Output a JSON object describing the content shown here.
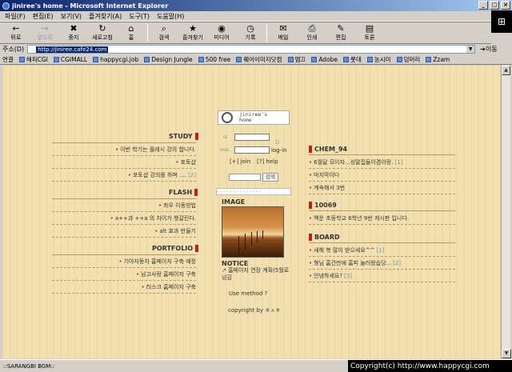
{
  "window": {
    "title": "jiniree's home - Microsoft Internet Explorer"
  },
  "menu": [
    "파일(F)",
    "편집(E)",
    "보기(V)",
    "즐겨찾기(A)",
    "도구(T)",
    "도움말(H)"
  ],
  "toolbar": [
    {
      "label": "뒤로",
      "icon": "back-arrow-icon",
      "glyph": "←",
      "disabled": false
    },
    {
      "label": "앞으로",
      "icon": "forward-arrow-icon",
      "glyph": "→",
      "disabled": true
    },
    {
      "label": "중지",
      "icon": "stop-icon",
      "glyph": "✖",
      "disabled": false
    },
    {
      "label": "새로고침",
      "icon": "refresh-icon",
      "glyph": "↻",
      "disabled": false
    },
    {
      "label": "홈",
      "icon": "home-icon",
      "glyph": "⌂",
      "disabled": false
    },
    {
      "label": "검색",
      "icon": "search-icon",
      "glyph": "⌕",
      "disabled": false
    },
    {
      "label": "즐겨찾기",
      "icon": "favorites-icon",
      "glyph": "★",
      "disabled": false
    },
    {
      "label": "미디어",
      "icon": "media-icon",
      "glyph": "◉",
      "disabled": false
    },
    {
      "label": "기록",
      "icon": "history-icon",
      "glyph": "◷",
      "disabled": false
    },
    {
      "label": "메일",
      "icon": "mail-icon",
      "glyph": "✉",
      "disabled": false
    },
    {
      "label": "인쇄",
      "icon": "print-icon",
      "glyph": "⎙",
      "disabled": false
    },
    {
      "label": "편집",
      "icon": "edit-icon",
      "glyph": "✎",
      "disabled": false
    },
    {
      "label": "토론",
      "icon": "discuss-icon",
      "glyph": "▤",
      "disabled": false
    }
  ],
  "address": {
    "label": "주소(D)",
    "url": "http://jiniree.cafe24.com",
    "go_label": "이동"
  },
  "links": {
    "label": "연결",
    "items": [
      "해피CGI",
      "CGIMALL",
      "happycgi.job",
      "Design Jungle",
      "500 free",
      "웨어이미지닷컴",
      "엠끄",
      "Adobe",
      "롯데",
      "농시미",
      "덩머리",
      "Zzam"
    ]
  },
  "left": {
    "study": {
      "title": "STUDY",
      "items": [
        {
          "text": "이번 학기는 플래시 강의 합니다.",
          "count": ""
        },
        {
          "text": "포토샵",
          "count": ""
        },
        {
          "text": "포토샵 강의를 하며 ....",
          "count": "[2]"
        }
      ]
    },
    "flash": {
      "title": "FLASH",
      "items": [
        {
          "text": "좌우 이동방법",
          "count": ""
        },
        {
          "text": "a++과 ++a 의 차이가 햇갈린다.",
          "count": ""
        },
        {
          "text": "alt 효과 만들기",
          "count": ""
        }
      ]
    },
    "portfolio": {
      "title": "PORTFOLIO",
      "items": [
        {
          "text": "기아자동차 홈페이지 구축 예정",
          "count": ""
        },
        {
          "text": "남고사랑 홈페이지 구축",
          "count": ""
        },
        {
          "text": "러스크 홈페이지 구축",
          "count": ""
        }
      ]
    }
  },
  "center": {
    "logo_line1": "jiniree's",
    "logo_line2": "home",
    "id_label": "ID",
    "pass_label": "PASS",
    "login_label": "log-in",
    "join_label": "[+] join",
    "help_label": "[?] help",
    "search_button": "검색",
    "select_text": "- - - - - - - - - - - - - -",
    "image_title": "IMAGE",
    "notice_title": "NOTICE",
    "notice_text": "홈페이지 연장 계획(5월로 넘김",
    "use_method": "Use method ?",
    "copyright": "copyright by ㅎㅅㅎ"
  },
  "right": {
    "chem": {
      "title": "CHEM_94",
      "items": [
        {
          "text": "6월달 모이자...성말집들이겸이랑.",
          "count": "[1]"
        },
        {
          "text": "마지막이다",
          "count": ""
        },
        {
          "text": "계속해서 3번",
          "count": ""
        }
      ]
    },
    "n10069": {
      "title": "10069",
      "items": [
        {
          "text": "백운 초등학교 6학년 9반 게시판 입니다.",
          "count": ""
        }
      ]
    },
    "board": {
      "title": "BOARD",
      "items": [
        {
          "text": "새해 복 많이 받으세요^^",
          "count": "[1]"
        },
        {
          "text": "형님 홈간만에 홈피 놀러왔습당...",
          "count": "[2]"
        },
        {
          "text": "안녕하세요?",
          "count": "[3]"
        }
      ]
    }
  },
  "status": {
    "text": "::SARANGBI BGM::",
    "copyright": "Copyright(c) http://www.happycgi.com"
  },
  "colors": {
    "accent": "#c0201a",
    "page_bg": "#f1dfae",
    "title_bar": "#0a246a"
  }
}
